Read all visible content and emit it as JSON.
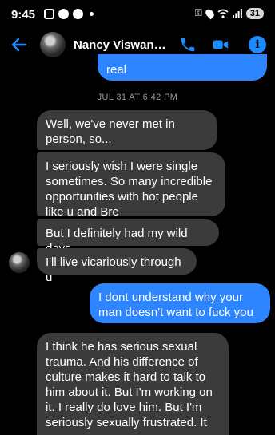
{
  "status_bar": {
    "time": "9:45",
    "battery": "31"
  },
  "header": {
    "contact_name": "Nancy Viswanat…"
  },
  "conversation": {
    "timestamp": "JUL 31 AT 6:42 PM",
    "messages": [
      {
        "from": "me",
        "text": "real"
      },
      {
        "from": "them",
        "text": "Well, we've never met in person, so..."
      },
      {
        "from": "them",
        "text": "I seriously wish I were single sometimes. So many incredible opportunities with hot people like u and Bre"
      },
      {
        "from": "them",
        "text": "But I definitely had my wild days"
      },
      {
        "from": "them",
        "text": "I'll live vicariously through u"
      },
      {
        "from": "me",
        "text": "I dont understand why your man doesn't want to fuck you"
      },
      {
        "from": "them",
        "text": "I think he has serious sexual trauma. And his difference of culture makes it hard to talk to him about it. But I'm working on it. I really do love him. But I'm seriously sexually frustrated. It wears on me"
      }
    ]
  },
  "colors": {
    "accent": "#1a8cff",
    "outgoing_bubble": "#2d86ff",
    "incoming_bubble": "#3b3b3b",
    "background": "#000000"
  }
}
